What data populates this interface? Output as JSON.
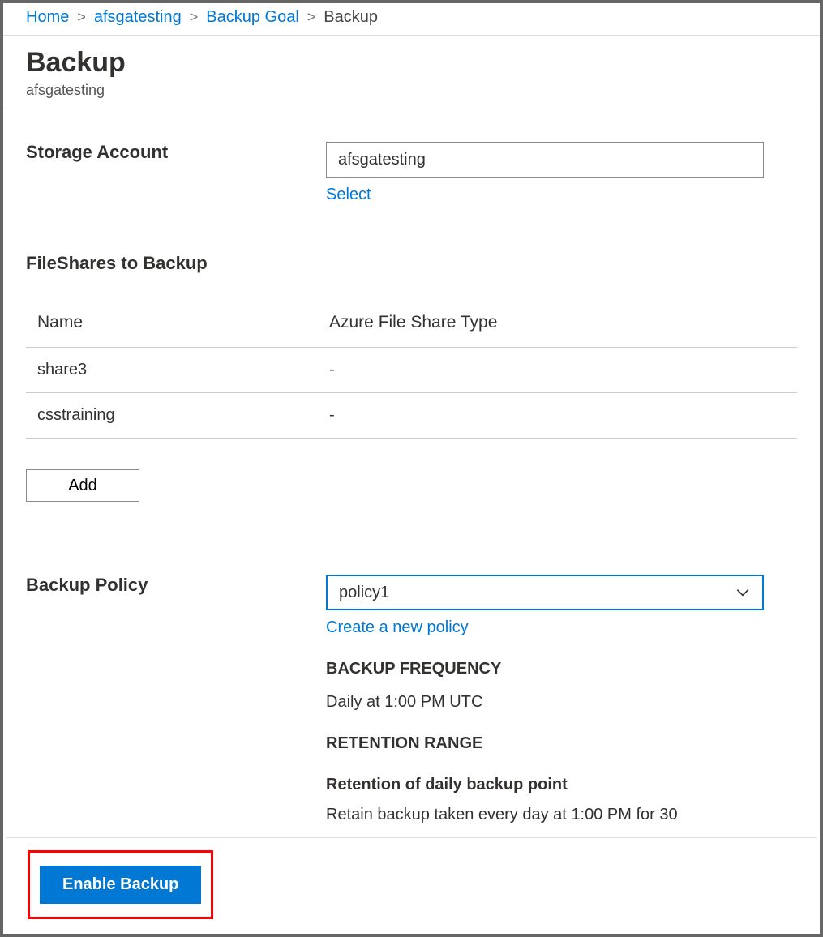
{
  "breadcrumb": {
    "home": "Home",
    "item1": "afsgatesting",
    "item2": "Backup Goal",
    "current": "Backup"
  },
  "header": {
    "title": "Backup",
    "subtitle": "afsgatesting"
  },
  "storage_account": {
    "label": "Storage Account",
    "value": "afsgatesting",
    "select_link": "Select"
  },
  "fileshares": {
    "heading": "FileShares to Backup",
    "columns": {
      "name": "Name",
      "type": "Azure File Share Type"
    },
    "rows": [
      {
        "name": "share3",
        "type": "-"
      },
      {
        "name": "csstraining",
        "type": "-"
      }
    ],
    "add_label": "Add"
  },
  "backup_policy": {
    "label": "Backup Policy",
    "selected": "policy1",
    "create_link": "Create a new policy",
    "freq_heading": "BACKUP FREQUENCY",
    "freq_text": "Daily at 1:00 PM UTC",
    "retention_heading": "RETENTION RANGE",
    "retention_sub": "Retention of daily backup point",
    "retention_text": "Retain backup taken every day at 1:00 PM for 30"
  },
  "footer": {
    "enable_label": "Enable Backup"
  }
}
